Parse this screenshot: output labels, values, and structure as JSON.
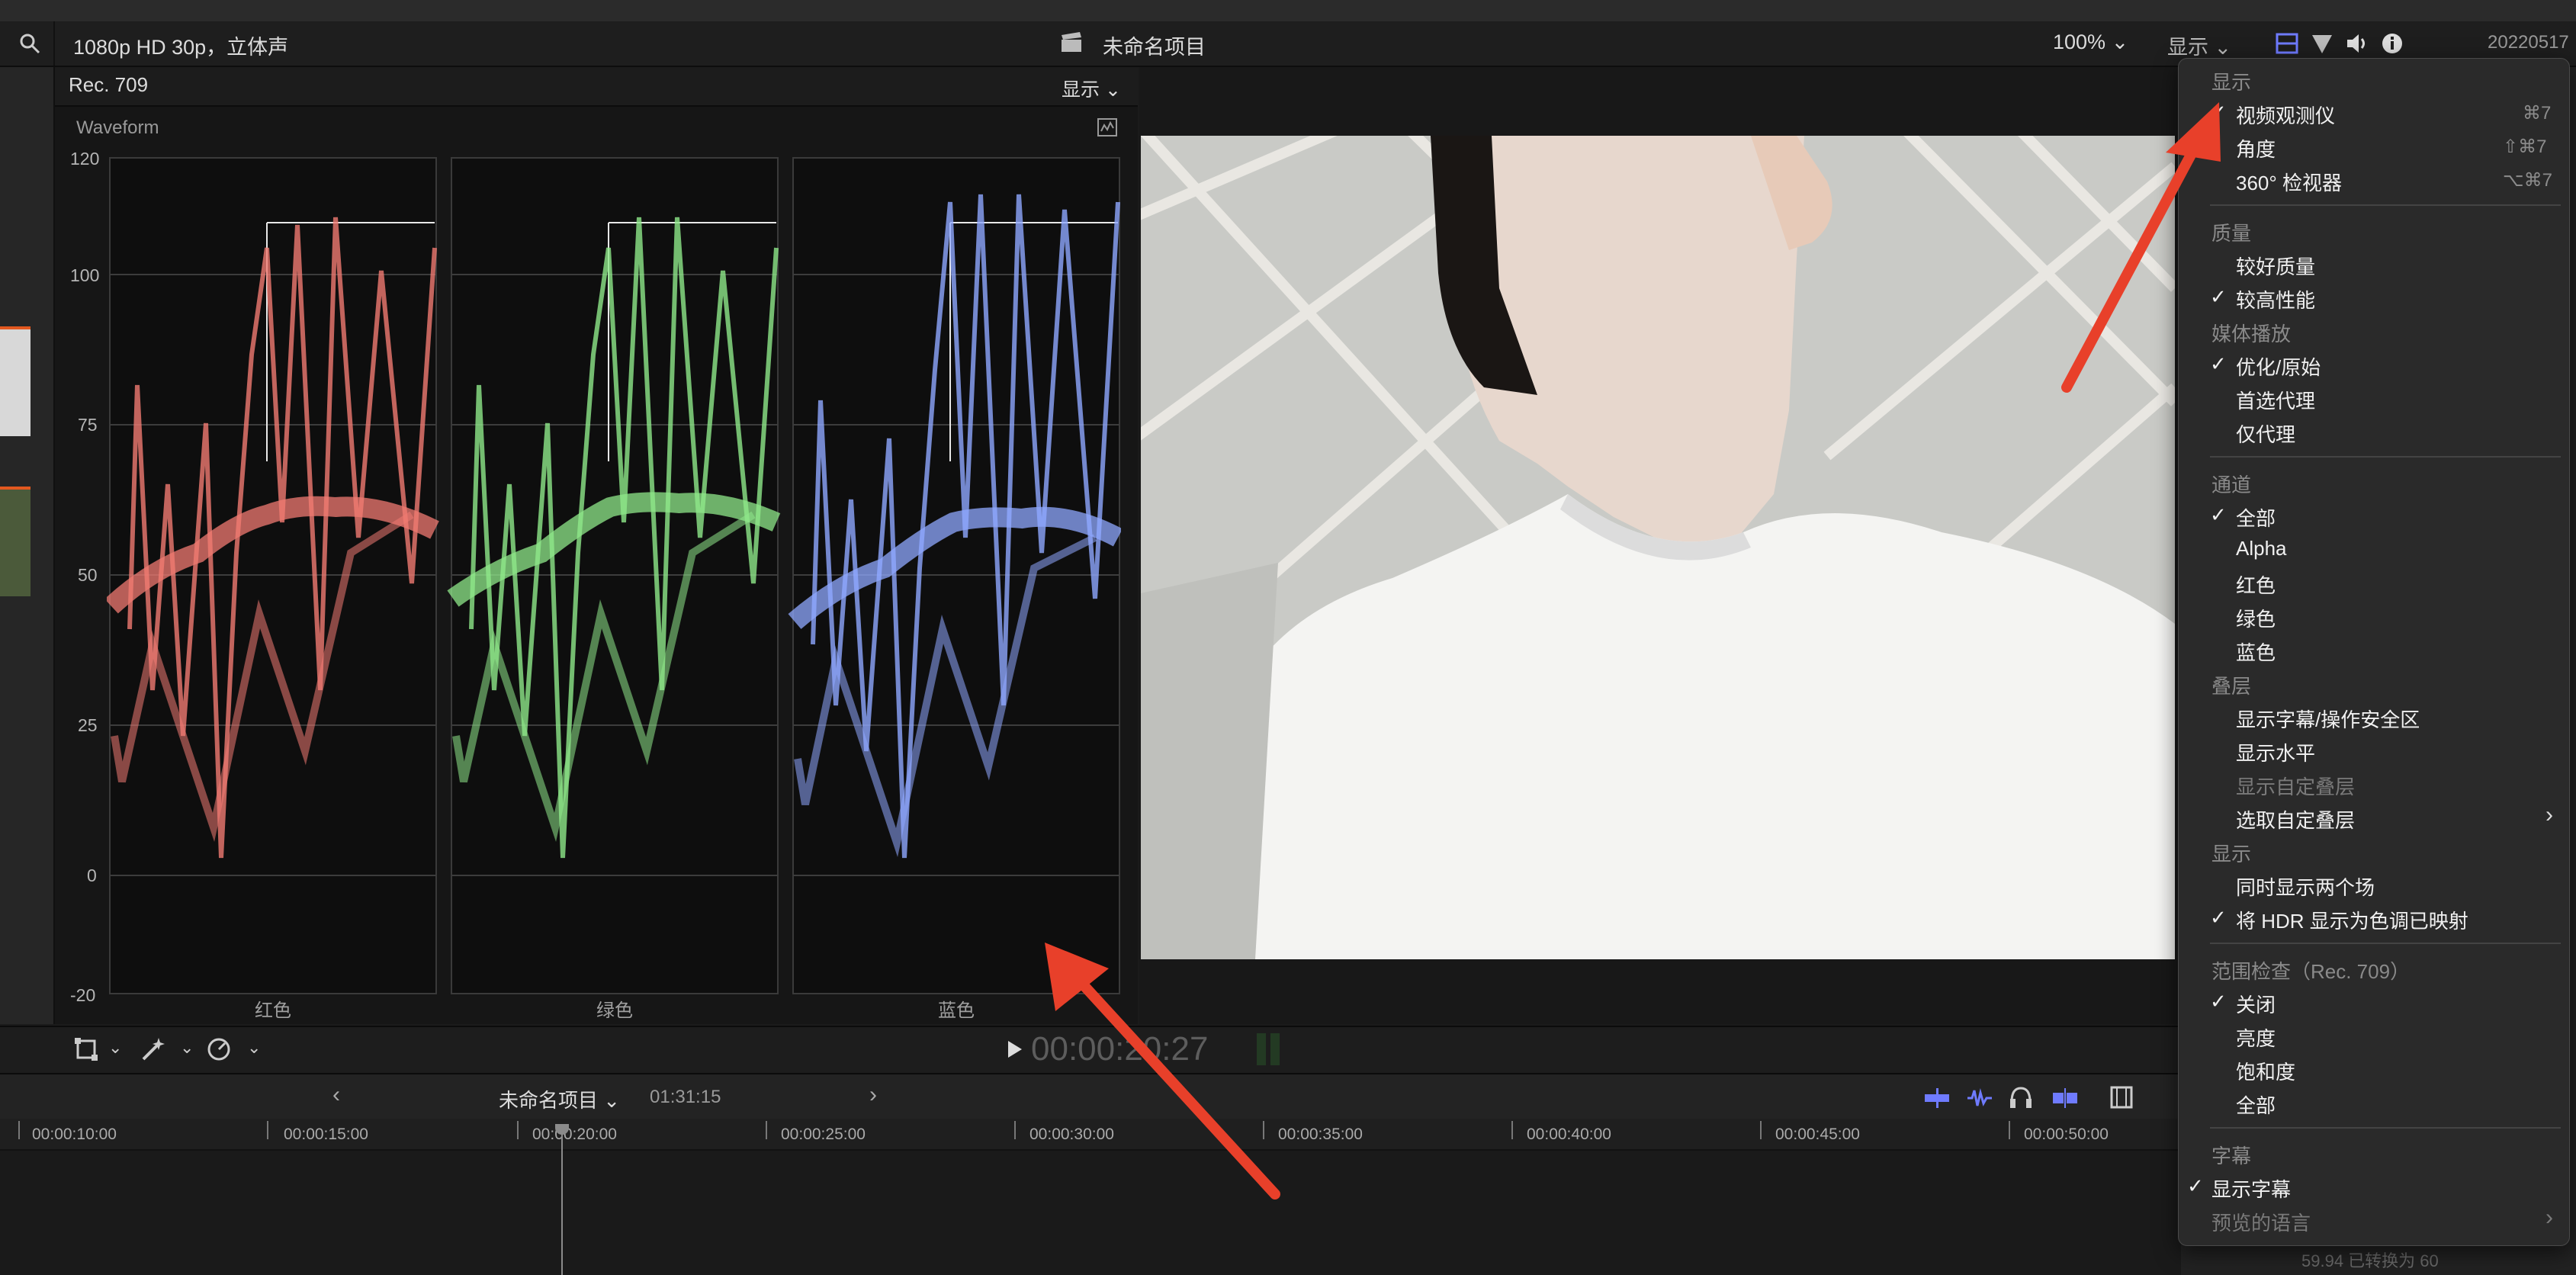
{
  "header": {
    "format_info": "1080p HD 30p，立体声",
    "project_title": "未命名项目",
    "zoom": "100%",
    "display_menu": "显示",
    "date_label": "20220517"
  },
  "scope": {
    "color_space": "Rec. 709",
    "display_menu": "显示",
    "title": "Waveform",
    "y_ticks": [
      "120",
      "100",
      "75",
      "50",
      "25",
      "0",
      "-20"
    ],
    "channels": [
      "红色",
      "绿色",
      "蓝色"
    ]
  },
  "transport": {
    "timecode": "00:00:20:27"
  },
  "timeline": {
    "project_name": "未命名项目",
    "duration": "01:31:15",
    "ruler": [
      "00:00:10:00",
      "00:00:15:00",
      "00:00:20:00",
      "00:00:25:00",
      "00:00:30:00",
      "00:00:35:00",
      "00:00:40:00",
      "00:00:45:00",
      "00:00:50:00"
    ],
    "status_text": "59.94 已转换为 60"
  },
  "menu": {
    "sections": [
      {
        "heading": "显示",
        "items": [
          {
            "label": "视频观测仪",
            "checked": true,
            "shortcut": "⌘7"
          },
          {
            "label": "角度",
            "checked": false,
            "shortcut": "⇧⌘7"
          },
          {
            "label": "360° 检视器",
            "checked": false,
            "shortcut": "⌥⌘7"
          }
        ]
      },
      {
        "heading": "质量",
        "items": [
          {
            "label": "较好质量",
            "checked": false
          },
          {
            "label": "较高性能",
            "checked": true
          }
        ]
      },
      {
        "heading": "媒体播放",
        "items": [
          {
            "label": "优化/原始",
            "checked": true
          },
          {
            "label": "首选代理",
            "checked": false
          },
          {
            "label": "仅代理",
            "checked": false
          }
        ]
      },
      {
        "heading": "通道",
        "items": [
          {
            "label": "全部",
            "checked": true
          },
          {
            "label": "Alpha",
            "checked": false
          },
          {
            "label": "红色",
            "checked": false
          },
          {
            "label": "绿色",
            "checked": false
          },
          {
            "label": "蓝色",
            "checked": false
          }
        ]
      },
      {
        "heading": "叠层",
        "items": [
          {
            "label": "显示字幕/操作安全区",
            "checked": false
          },
          {
            "label": "显示水平",
            "checked": false
          },
          {
            "label": "显示自定叠层",
            "checked": false,
            "disabled": true
          },
          {
            "label": "选取自定叠层",
            "checked": false,
            "submenu": true
          }
        ]
      },
      {
        "heading": "显示",
        "items": [
          {
            "label": "同时显示两个场",
            "checked": false
          },
          {
            "label": "将 HDR 显示为色调已映射",
            "checked": true
          }
        ]
      },
      {
        "heading": "范围检查（Rec. 709）",
        "items": [
          {
            "label": "关闭",
            "checked": true
          },
          {
            "label": "亮度",
            "checked": false
          },
          {
            "label": "饱和度",
            "checked": false
          },
          {
            "label": "全部",
            "checked": false
          }
        ]
      },
      {
        "heading": "字幕",
        "items": [
          {
            "label": "显示字幕",
            "checked": true
          },
          {
            "label": "预览的语言",
            "checked": false,
            "disabled": true,
            "submenu": true
          }
        ]
      }
    ]
  },
  "colors": {
    "red_trace": "#f07a72",
    "green_trace": "#8fe88a",
    "blue_trace": "#8fa8ff",
    "annotation_arrow": "#e8402a"
  }
}
